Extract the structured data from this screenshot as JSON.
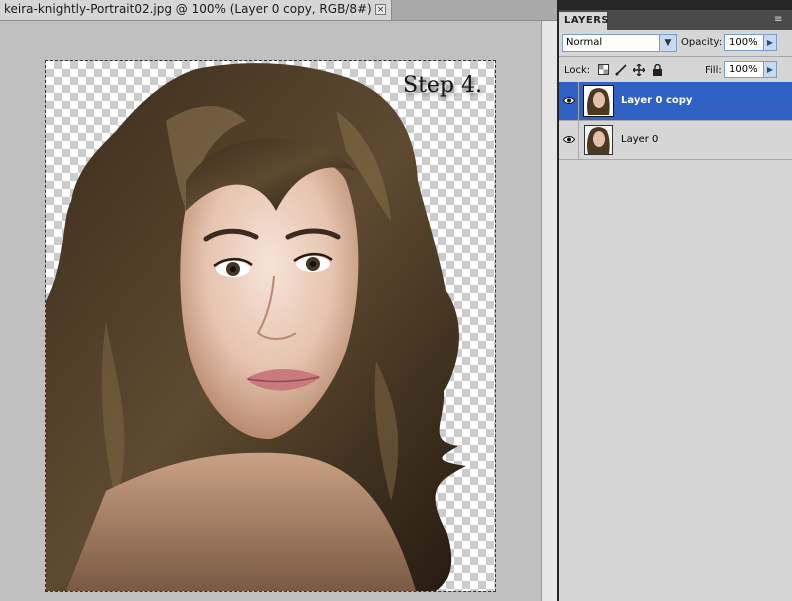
{
  "document": {
    "tab_title": "keira-knightly-Portrait02.jpg @ 100% (Layer 0 copy, RGB/8#) *",
    "close_glyph": "×",
    "step_text": "Step 4."
  },
  "layers_panel": {
    "tab_label": "LAYERS",
    "blend_mode": "Normal",
    "opacity_label": "Opacity:",
    "opacity_value": "100%",
    "lock_label": "Lock:",
    "fill_label": "Fill:",
    "fill_value": "100%",
    "lock_icons": [
      "lock-transparent-icon",
      "lock-image-icon",
      "lock-position-icon",
      "lock-all-icon"
    ],
    "layers": [
      {
        "name": "Layer 0 copy",
        "selected": true,
        "visible": true
      },
      {
        "name": "Layer 0",
        "selected": false,
        "visible": true
      }
    ]
  },
  "colors": {
    "selection": "#2f62c2",
    "panel_bg": "#d6d6d6",
    "canvas_bg": "#c0c0c0"
  }
}
